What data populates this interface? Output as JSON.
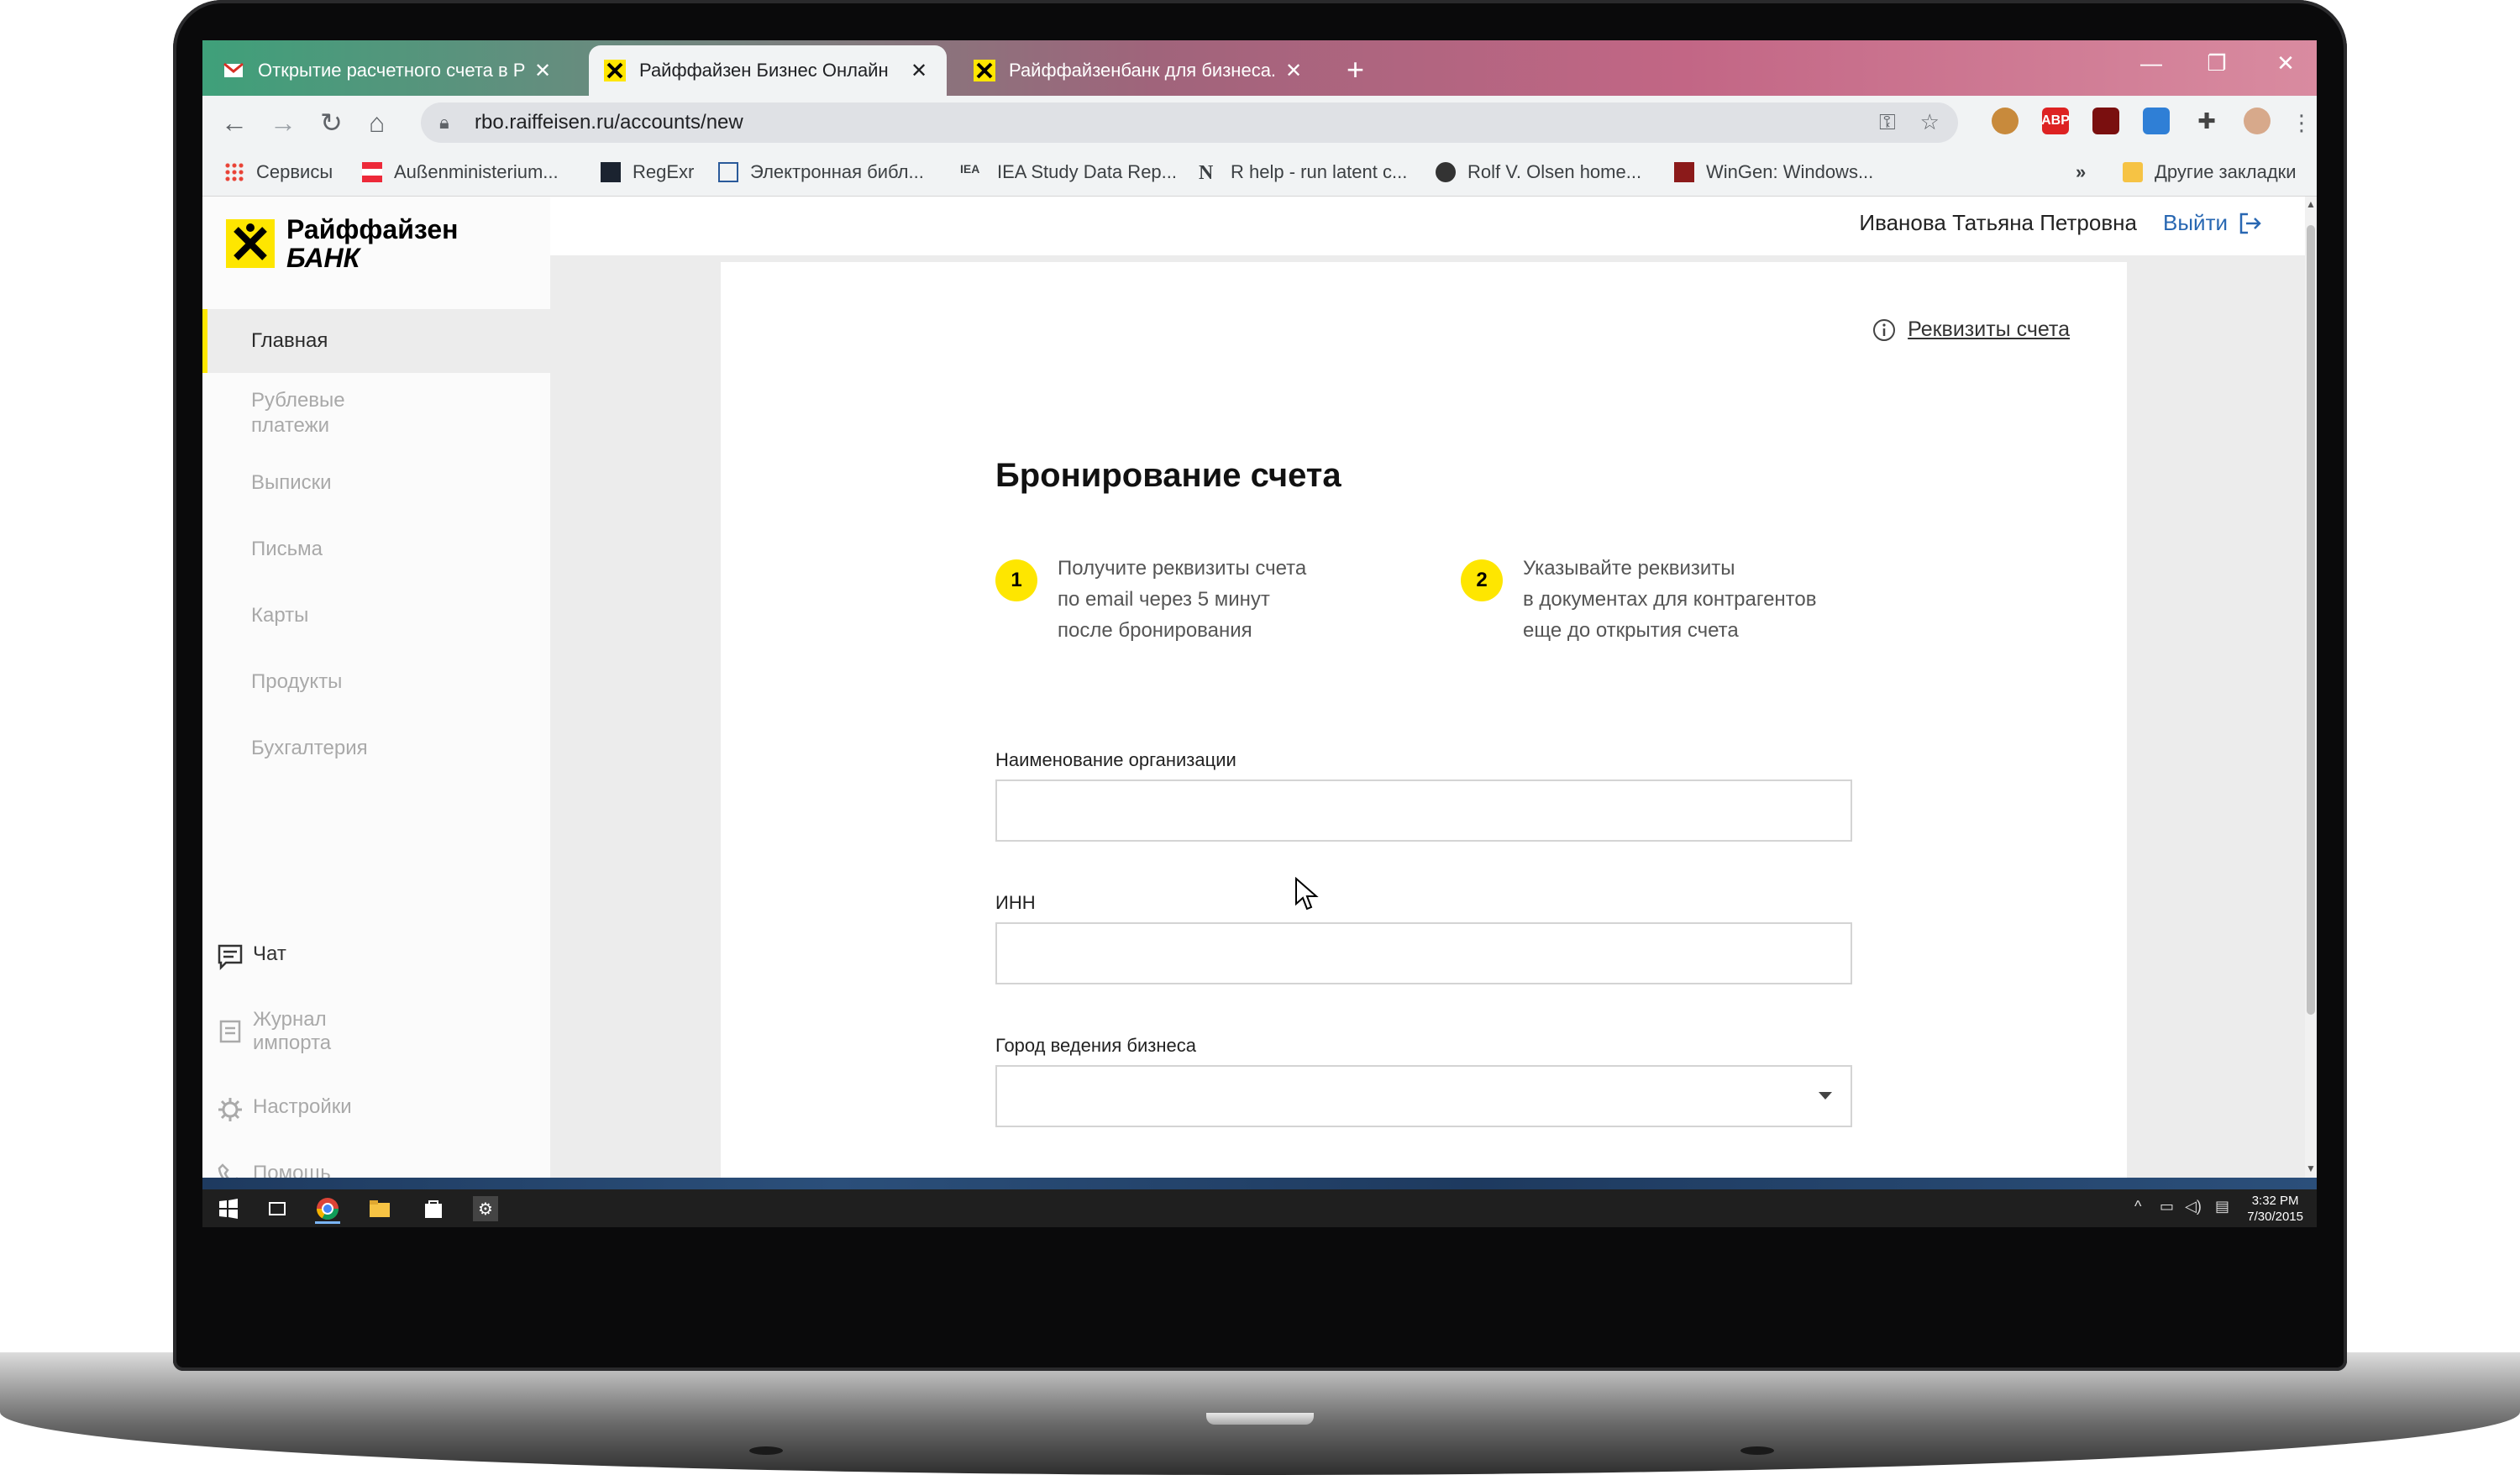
{
  "browser": {
    "tabs": [
      {
        "label": "Открытие расчетного счета в Р",
        "icon": "gmail-icon"
      },
      {
        "label": "Райффайзен Бизнес Онлайн",
        "icon": "raiffeisen-icon",
        "active": true
      },
      {
        "label": "Райффайзенбанк для бизнеса. С",
        "icon": "raiffeisen-icon"
      }
    ],
    "url": "rbo.raiffeisen.ru/accounts/new",
    "bookmarks": [
      "Сервисы",
      "Außenministerium...",
      "RegExr",
      "Электронная библ...",
      "IEA Study Data Rep...",
      "R help - run latent c...",
      "Rolf V. Olsen home...",
      "WinGen: Windows..."
    ],
    "bookmarks_overflow": "»",
    "other_bookmarks": "Другие закладки",
    "ext_abp": "ABP"
  },
  "sidebar": {
    "brand_line1": "Райффайзен",
    "brand_line2": "БАНК",
    "items": [
      "Главная",
      "Рублевые\nплатежи",
      "Выписки",
      "Письма",
      "Карты",
      "Продукты",
      "Бухгалтерия"
    ],
    "bottom": {
      "chat": "Чат",
      "import_log": "Журнал\nимпорта",
      "settings": "Настройки",
      "help": "Помощь"
    }
  },
  "header": {
    "user_name": "Иванова Татьяна Петровна",
    "logout": "Выйти"
  },
  "main": {
    "requisites_link": "Реквизиты счета",
    "title": "Бронирование счета",
    "steps": [
      {
        "num": "1",
        "text": "Получите реквизиты счета\nпо email через 5 минут\nпосле бронирования"
      },
      {
        "num": "2",
        "text": "Указывайте реквизиты\nв документах для контрагентов\nеще до открытия счета"
      }
    ],
    "fields": {
      "org_name_label": "Наименование организации",
      "org_name_value": "",
      "inn_label": "ИНН",
      "inn_value": "",
      "city_label": "Город ведения бизнеса",
      "city_value": ""
    }
  },
  "taskbar": {
    "time": "3:32 PM",
    "date": "7/30/2015"
  },
  "colors": {
    "brand_yellow": "#fee600",
    "link_blue": "#2867b2"
  }
}
